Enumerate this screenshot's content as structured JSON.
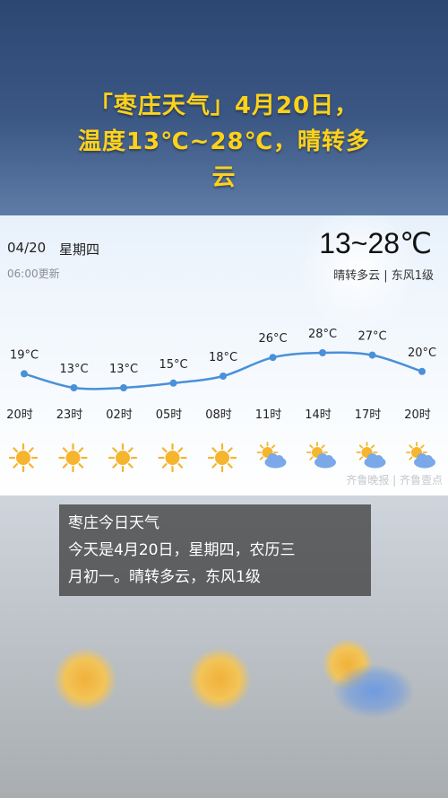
{
  "header": {
    "line1": "「枣庄天气」4月20日，",
    "line2": "温度13℃~28℃，晴转多",
    "line3": "云"
  },
  "weather_card": {
    "date": "04/20",
    "weekday": "星期四",
    "updated": "06:00更新",
    "temp_range": "13~28℃",
    "condition": "晴转多云 | 东风1级",
    "watermark": "齐鲁晚报 | 齐鲁壹点"
  },
  "hourly": [
    {
      "time": "20时",
      "temp": 19,
      "temp_label": "19°C",
      "icon": "sunny-icon"
    },
    {
      "time": "23时",
      "temp": 13,
      "temp_label": "13°C",
      "icon": "sunny-icon"
    },
    {
      "time": "02时",
      "temp": 13,
      "temp_label": "13°C",
      "icon": "sunny-icon"
    },
    {
      "time": "05时",
      "temp": 15,
      "temp_label": "15°C",
      "icon": "sunny-icon"
    },
    {
      "time": "08时",
      "temp": 18,
      "temp_label": "18°C",
      "icon": "sunny-icon"
    },
    {
      "time": "11时",
      "temp": 26,
      "temp_label": "26°C",
      "icon": "partly-cloudy-icon"
    },
    {
      "time": "14时",
      "temp": 28,
      "temp_label": "28°C",
      "icon": "partly-cloudy-icon"
    },
    {
      "time": "17时",
      "temp": 27,
      "temp_label": "27°C",
      "icon": "partly-cloudy-icon"
    },
    {
      "time": "20时",
      "temp": 20,
      "temp_label": "20°C",
      "icon": "partly-cloudy-icon"
    }
  ],
  "subtitle": {
    "line1": "枣庄今日天气",
    "line2": "今天是4月20日，星期四，农历三",
    "line3": "月初一。晴转多云，东风1级"
  },
  "colors": {
    "headline": "#ffd21a",
    "line": "#4a90d9",
    "sun": "#f5b52e",
    "cloud": "#7aa8e8"
  }
}
